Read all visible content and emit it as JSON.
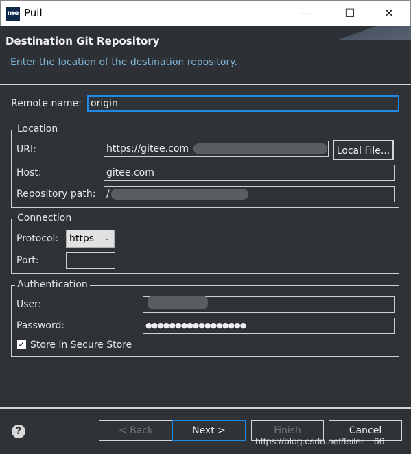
{
  "window": {
    "title": "Pull",
    "logo": "me",
    "minimize": "—",
    "maximize": "☐",
    "close": "✕"
  },
  "header": {
    "title": "Destination Git Repository",
    "description": "Enter the location of the destination repository."
  },
  "remote": {
    "label": "Remote name:",
    "value": "origin"
  },
  "location": {
    "legend": "Location",
    "uri_label": "URI:",
    "uri_value": "https://gitee.com",
    "local_file": "Local File...",
    "host_label": "Host:",
    "host_value": "gitee.com",
    "path_label": "Repository path:",
    "path_value": "/"
  },
  "connection": {
    "legend": "Connection",
    "protocol_label": "Protocol:",
    "protocol_value": "https",
    "port_label": "Port:",
    "port_value": ""
  },
  "auth": {
    "legend": "Authentication",
    "user_label": "User:",
    "password_label": "Password:",
    "password_value": "●●●●●●●●●●●●●●●●●",
    "store_label": "Store in Secure Store",
    "store_checked": true
  },
  "buttons": {
    "back": "< Back",
    "next": "Next >",
    "finish": "Finish",
    "cancel": "Cancel"
  },
  "watermark": "https://blog.csdn.net/leilei__66",
  "colors": {
    "accent": "#1e8ae6",
    "description": "#7fb6d8",
    "background": "#2f3237"
  }
}
